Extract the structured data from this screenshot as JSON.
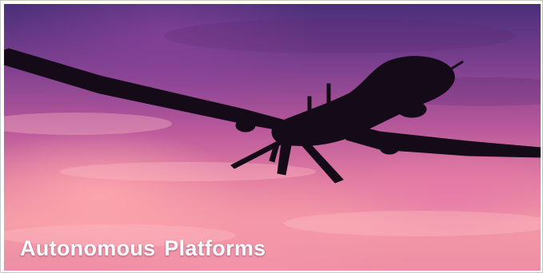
{
  "caption": {
    "title": "Autonomous Platforms"
  },
  "image": {
    "subject": "drone-silhouette-icon",
    "sky_top_color": "#4a2f7a",
    "sky_bottom_color": "#f49aa6",
    "silhouette_color": "#150a18"
  }
}
